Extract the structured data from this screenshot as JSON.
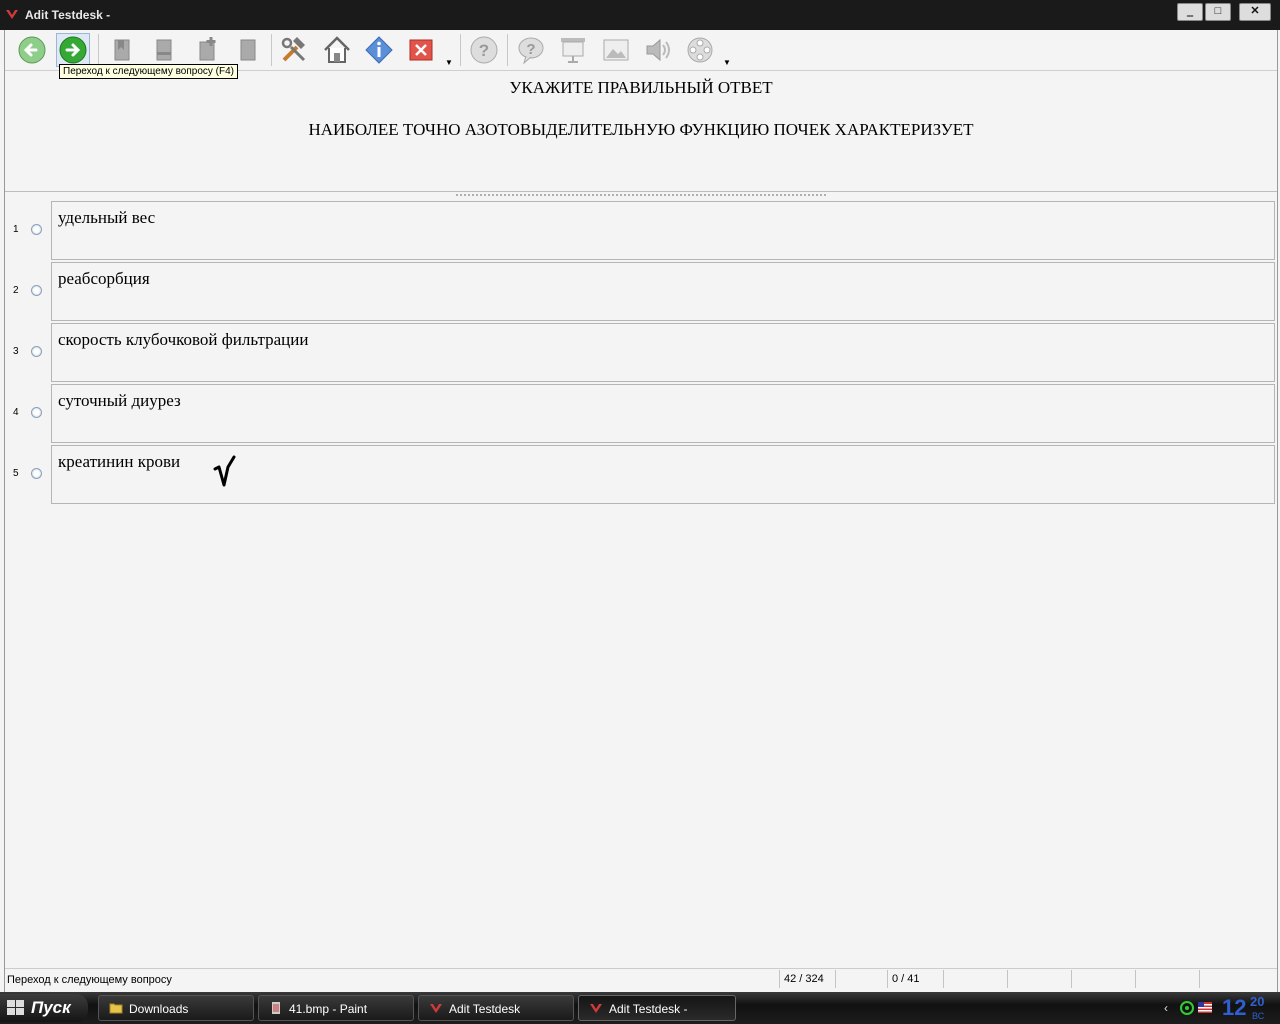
{
  "window": {
    "title": "Adit Testdesk -",
    "controls": {
      "minimize": "‗",
      "maximize": "□",
      "close": "✕"
    }
  },
  "toolbar": {
    "tooltip": "Переход к следующему вопросу (F4)",
    "buttons": [
      {
        "name": "back-icon"
      },
      {
        "name": "forward-icon"
      },
      {
        "name": "bookmark-icon"
      },
      {
        "name": "bookmark-2-icon"
      },
      {
        "name": "bookmark-add-icon"
      },
      {
        "name": "bookmark-3-icon"
      },
      {
        "name": "tools-icon"
      },
      {
        "name": "home-icon"
      },
      {
        "name": "info-icon"
      },
      {
        "name": "close-test-icon"
      },
      {
        "name": "help-icon"
      },
      {
        "name": "hint-icon"
      },
      {
        "name": "presentation-icon"
      },
      {
        "name": "image-icon"
      },
      {
        "name": "sound-icon"
      },
      {
        "name": "video-icon"
      }
    ]
  },
  "question": {
    "instruction": "УКАЖИТЕ ПРАВИЛЬНЫЙ ОТВЕТ",
    "text": "НАИБОЛЕЕ ТОЧНО АЗОТОВЫДЕЛИТЕЛЬНУЮ ФУНКЦИЮ ПОЧЕК ХАРАКТЕРИЗУЕТ"
  },
  "answers": [
    {
      "num": "1",
      "text": "удельный вес"
    },
    {
      "num": "2",
      "text": "реабсорбция"
    },
    {
      "num": "3",
      "text": "скорость клубочковой фильтрации"
    },
    {
      "num": "4",
      "text": "суточный диурез"
    },
    {
      "num": "5",
      "text": "креатинин крови"
    }
  ],
  "status": {
    "message": "Переход к следующему вопросу",
    "question_counter": "42 / 324",
    "score": "0 / 41"
  },
  "taskbar": {
    "start_label": "Пуск",
    "tasks": [
      {
        "label": "Downloads"
      },
      {
        "label": "41.bmp - Paint"
      },
      {
        "label": "Adit Testdesk"
      },
      {
        "label": "Adit Testdesk -"
      }
    ],
    "clock_hour": "12",
    "clock_minute": "20",
    "clock_day": "ВС"
  }
}
